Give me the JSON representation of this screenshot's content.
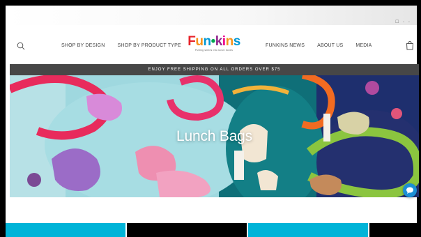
{
  "brand": {
    "logo_word": "Funkins",
    "tagline": "Putting smiles into lunch boxes",
    "colors": {
      "red": "#e7232a",
      "orange": "#f7941d",
      "blue": "#0098d4",
      "green": "#00a651",
      "purple": "#92278f",
      "pink": "#ec008c"
    }
  },
  "topbar": {
    "mini_text": "☐ ◦ ◦"
  },
  "nav": {
    "left": [
      "SHOP BY DESIGN",
      "SHOP BY PRODUCT TYPE"
    ],
    "right": [
      "FUNKINS NEWS",
      "ABOUT US",
      "MEDIA"
    ]
  },
  "icons": {
    "search": "search-icon",
    "cart": "shopping-bag-icon",
    "chat": "chat-icon"
  },
  "promo": {
    "text": "ENJOY FREE SHIPPING ON ALL ORDERS OVER $75",
    "background": "#474747"
  },
  "hero": {
    "title": "Lunch Bags"
  },
  "cards": [
    {
      "color": "#00b4d8"
    },
    {
      "color": "#000000"
    },
    {
      "color": "#00b4d8"
    },
    {
      "color": "#000000"
    }
  ]
}
